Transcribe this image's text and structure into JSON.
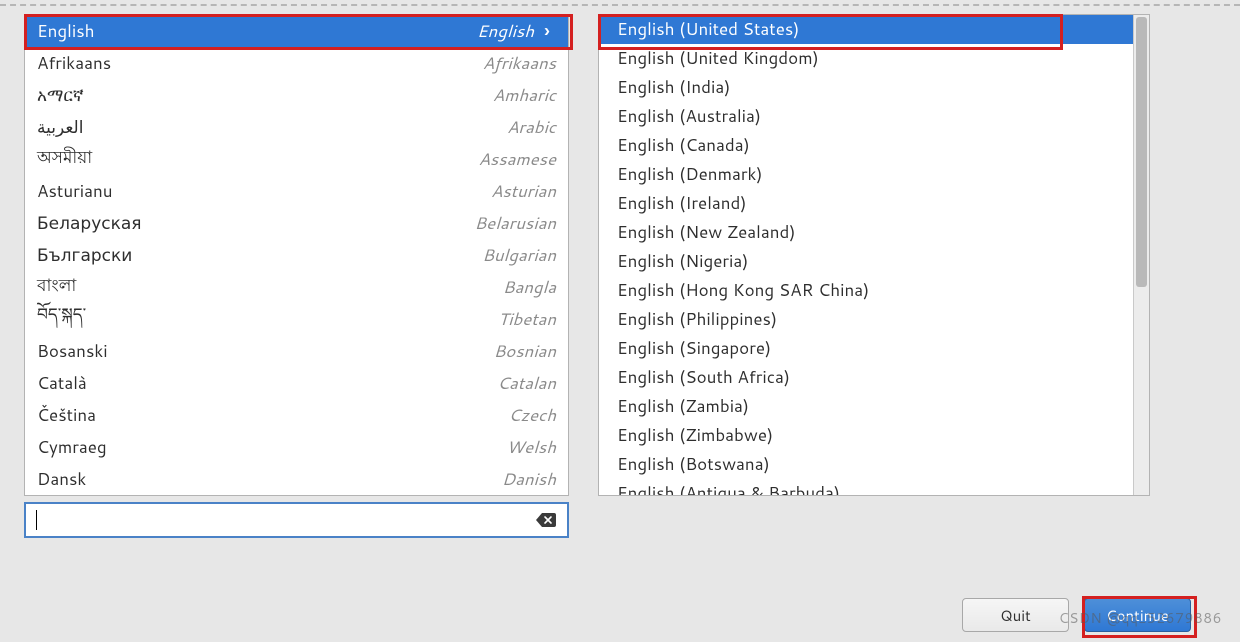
{
  "colors": {
    "accent": "#2f78d4",
    "highlight_border": "#d42020"
  },
  "languages": [
    {
      "native": "English",
      "english": "English",
      "selected": true
    },
    {
      "native": "Afrikaans",
      "english": "Afrikaans",
      "selected": false
    },
    {
      "native": "አማርኛ",
      "english": "Amharic",
      "selected": false
    },
    {
      "native": "العربية",
      "english": "Arabic",
      "selected": false
    },
    {
      "native": "অসমীয়া",
      "english": "Assamese",
      "selected": false
    },
    {
      "native": "Asturianu",
      "english": "Asturian",
      "selected": false
    },
    {
      "native": "Беларуская",
      "english": "Belarusian",
      "selected": false
    },
    {
      "native": "Български",
      "english": "Bulgarian",
      "selected": false
    },
    {
      "native": "বাংলা",
      "english": "Bangla",
      "selected": false
    },
    {
      "native": "བོད་སྐད་",
      "english": "Tibetan",
      "selected": false
    },
    {
      "native": "Bosanski",
      "english": "Bosnian",
      "selected": false
    },
    {
      "native": "Català",
      "english": "Catalan",
      "selected": false
    },
    {
      "native": "Čeština",
      "english": "Czech",
      "selected": false
    },
    {
      "native": "Cymraeg",
      "english": "Welsh",
      "selected": false
    },
    {
      "native": "Dansk",
      "english": "Danish",
      "selected": false
    }
  ],
  "locales": [
    {
      "label": "English (United States)",
      "selected": true
    },
    {
      "label": "English (United Kingdom)",
      "selected": false
    },
    {
      "label": "English (India)",
      "selected": false
    },
    {
      "label": "English (Australia)",
      "selected": false
    },
    {
      "label": "English (Canada)",
      "selected": false
    },
    {
      "label": "English (Denmark)",
      "selected": false
    },
    {
      "label": "English (Ireland)",
      "selected": false
    },
    {
      "label": "English (New Zealand)",
      "selected": false
    },
    {
      "label": "English (Nigeria)",
      "selected": false
    },
    {
      "label": "English (Hong Kong SAR China)",
      "selected": false
    },
    {
      "label": "English (Philippines)",
      "selected": false
    },
    {
      "label": "English (Singapore)",
      "selected": false
    },
    {
      "label": "English (South Africa)",
      "selected": false
    },
    {
      "label": "English (Zambia)",
      "selected": false
    },
    {
      "label": "English (Zimbabwe)",
      "selected": false
    },
    {
      "label": "English (Botswana)",
      "selected": false
    },
    {
      "label": "English (Antigua & Barbuda)",
      "selected": false
    }
  ],
  "search": {
    "value": "",
    "placeholder": ""
  },
  "buttons": {
    "quit": "Quit",
    "continue": "Continue"
  },
  "watermark": "CSDN @qq_52679886"
}
